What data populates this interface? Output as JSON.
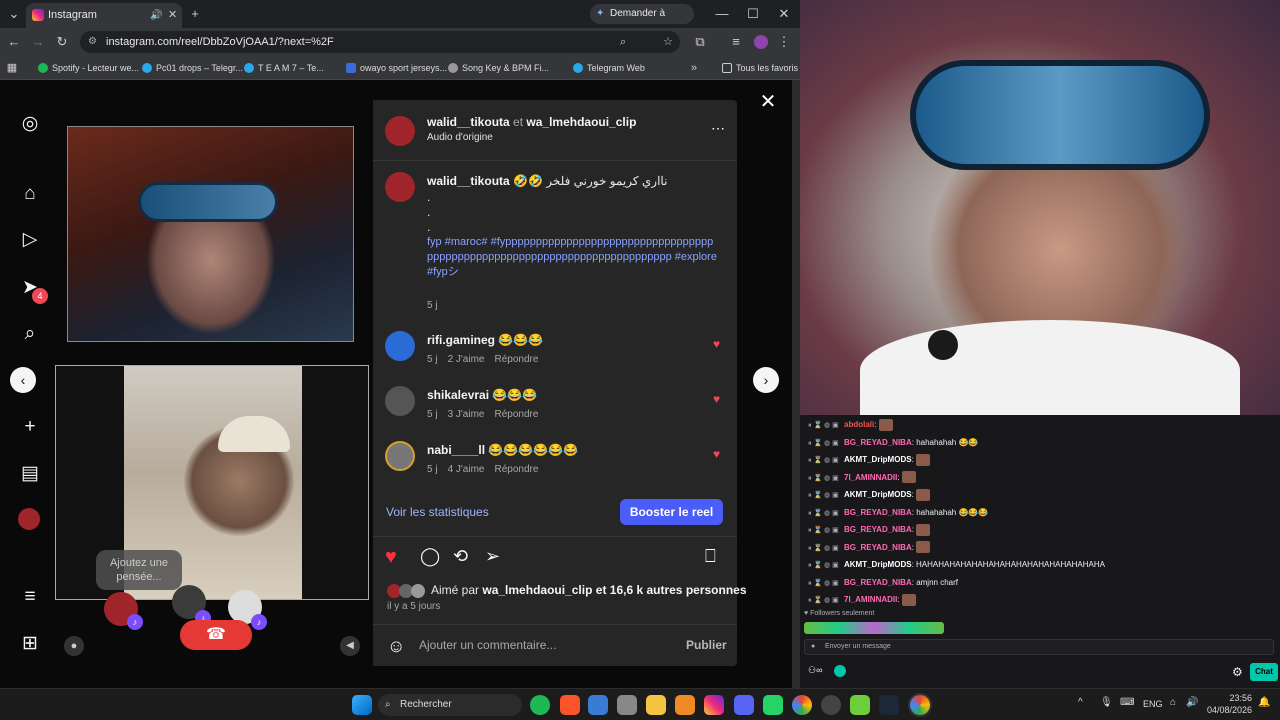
{
  "browser": {
    "tab_title": "Instagram",
    "gemini_button": "Demander à Gemini",
    "url": "instagram.com/reel/DbbZoVjOAA1/?next=%2F",
    "bookmarks": [
      "Spotify - Lecteur we...",
      "Pc01 drops – Telegr...",
      "T E A M 7 – Te...",
      "owayo sport jerseys...",
      "Song Key & BPM Fi...",
      "Telegram Web"
    ],
    "all_bookmarks": "Tous les favoris"
  },
  "sidebar": {
    "notif_badge": "4"
  },
  "call": {
    "bubble_text": "Ajoutez une pensée..."
  },
  "post": {
    "authors_a": "walid__tikouta",
    "authors_sep": "et",
    "authors_b": "wa_lmehdaoui_clip",
    "audio": "Audio d'origine",
    "caption_user": "walid__tikouta",
    "caption_text": "🤣🤣 نااري كريمو خورني فلخر",
    "caption_dots": [
      ".",
      ".",
      "."
    ],
    "caption_tags": "fyp #maroc# #fypppppppppppppppppppppppppppppppppppppppppppppppppppppppppppppppppppppppppp #explore #fypシ",
    "caption_time": "5 j",
    "comments": [
      {
        "user": "rifi.gamineg",
        "text": "😂😂😂",
        "time": "5 j",
        "likes": "2 J'aime",
        "reply": "Répondre"
      },
      {
        "user": "shikalevrai",
        "text": "😂😂😂",
        "time": "5 j",
        "likes": "3 J'aime",
        "reply": "Répondre"
      },
      {
        "user": "nabi____ll",
        "text": "😂😂😂😂😂😂",
        "time": "5 j",
        "likes": "4 J'aime",
        "reply": "Répondre"
      }
    ],
    "stats_link": "Voir les statistiques",
    "boost_button": "Booster le reel",
    "liked_prefix": "Aimé par",
    "liked_user": "wa_lmehdaoui_clip",
    "liked_suffix": "et 16,6 k autres personnes",
    "posted_time": "il y a 5 jours",
    "comment_placeholder": "Ajouter un commentaire...",
    "publish": "Publier"
  },
  "chat": {
    "rows": [
      {
        "user": "abdolali",
        "color": "#ff4d4d",
        "msg": ""
      },
      {
        "user": "BG_REYAD_NIBA",
        "color": "#ff69b4",
        "msg": "hahahahah 😂😂"
      },
      {
        "user": "AKMT_DripMODS",
        "color": "#ffffff",
        "msg": ""
      },
      {
        "user": "7l_AMINNADII",
        "color": "#ff69b4",
        "msg": ""
      },
      {
        "user": "AKMT_DripMODS",
        "color": "#ffffff",
        "msg": ""
      },
      {
        "user": "BG_REYAD_NIBA",
        "color": "#ff69b4",
        "msg": "hahahahah 😂😂😂"
      },
      {
        "user": "BG_REYAD_NIBA",
        "color": "#ff69b4",
        "msg": ""
      },
      {
        "user": "BG_REYAD_NIBA",
        "color": "#ff69b4",
        "msg": ""
      },
      {
        "user": "AKMT_DripMODS",
        "color": "#ffffff",
        "msg": "HAHAHAHAHAHAHAHAHAHAHAHAHAHAHAHAHA"
      },
      {
        "user": "BG_REYAD_NIBA",
        "color": "#ff69b4",
        "msg": "amjnn charf"
      },
      {
        "user": "7l_AMINNADII",
        "color": "#ff69b4",
        "msg": ""
      }
    ],
    "followers_only": "Followers seulement",
    "input_placeholder": "Envoyer un message",
    "chat_button": "Chat"
  },
  "taskbar": {
    "search": "Rechercher",
    "lang": "ENG",
    "time": "23:56",
    "date": "04/08/2026"
  }
}
